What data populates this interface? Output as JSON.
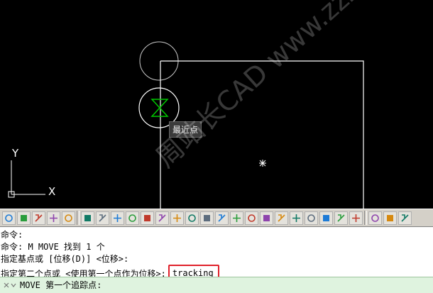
{
  "tooltip": {
    "text": "最近点"
  },
  "watermark": {
    "text": "周站长CAD    www.zzzcad.com"
  },
  "axis": {
    "x_label": "X",
    "y_label": "Y"
  },
  "toolbar": {
    "icons": [
      "layer-icon",
      "object-icon",
      "vscurrent-icon",
      "xref-icon",
      "block-icon",
      "snap-circle-icon",
      "snap-grid-icon",
      "snap-square-icon",
      "snap-point-icon",
      "snap-endpoint-icon",
      "snap-midpoint-icon",
      "snap-intersection-icon",
      "snap-mirror-icon",
      "snap-center-icon",
      "snap-quadrant-icon",
      "snap-tangent-icon",
      "snap-perpendicular-icon",
      "snap-parallel-icon",
      "snap-insert-icon",
      "snap-node-icon",
      "snap-nearest-icon",
      "snap-none-icon",
      "snap-settings-icon",
      "snap-extra-icon",
      "hatch-icon",
      "table-icon",
      "more-icon"
    ]
  },
  "command_history": {
    "lines": [
      "命令:",
      "命令: M MOVE 找到 1 个",
      "指定基点或 [位移(D)] <位移>:",
      "指定第二个点或 <使用第一个点作为位移>:"
    ],
    "input_value": "tracking"
  },
  "command_prompt": {
    "text": "MOVE 第一个追踪点:"
  },
  "colors": {
    "highlight_border": "#e0202a",
    "prompt_bg": "#dff3df",
    "hourglass": "#00c800"
  }
}
